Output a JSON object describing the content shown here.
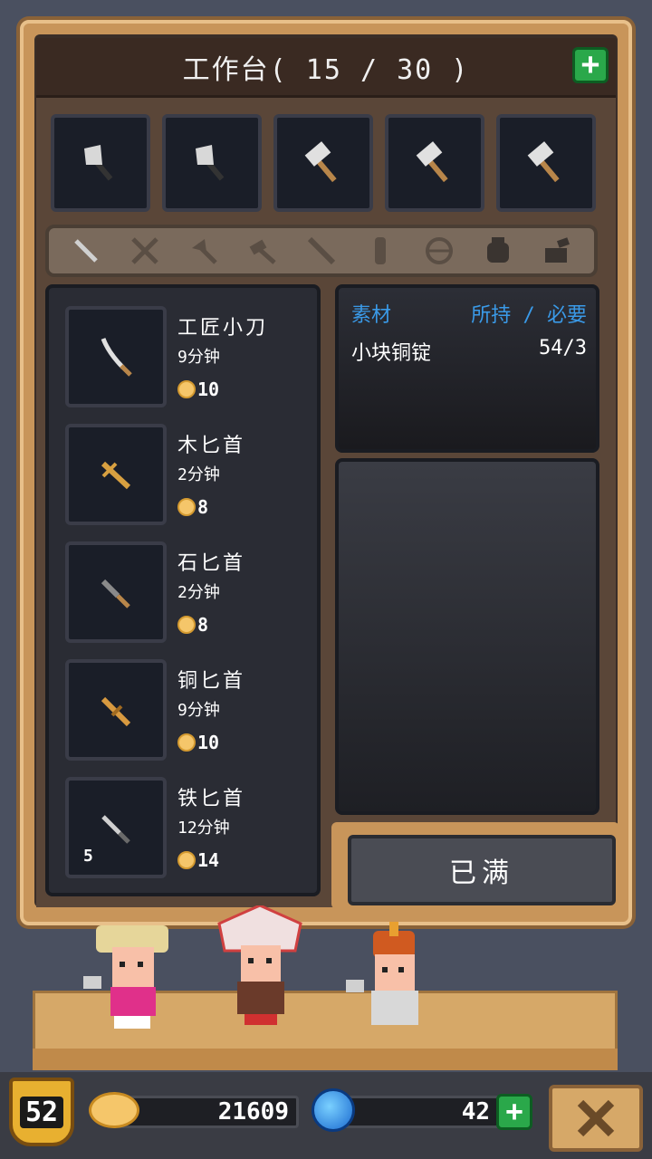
{
  "header": {
    "title": "工作台( 15 / 30 )",
    "add_label": "+"
  },
  "slots": [
    "axe-icon",
    "axe-icon",
    "hammer-icon",
    "hammer-icon",
    "hammer-icon"
  ],
  "categories": [
    "dagger-icon",
    "sword-icon",
    "axe-icon",
    "hammer-icon",
    "spear-icon",
    "mace-icon",
    "bow-icon",
    "armor-icon",
    "helmet-icon"
  ],
  "recipes": [
    {
      "name": "工匠小刀",
      "time": "9分钟",
      "cost": "10",
      "count": "",
      "icon": "knife-icon"
    },
    {
      "name": "木匕首",
      "time": "2分钟",
      "cost": "8",
      "count": "",
      "icon": "wood-dagger-icon"
    },
    {
      "name": "石匕首",
      "time": "2分钟",
      "cost": "8",
      "count": "",
      "icon": "stone-dagger-icon"
    },
    {
      "name": "铜匕首",
      "time": "9分钟",
      "cost": "10",
      "count": "",
      "icon": "copper-dagger-icon"
    },
    {
      "name": "铁匕首",
      "time": "12分钟",
      "cost": "14",
      "count": "5",
      "icon": "iron-dagger-icon"
    }
  ],
  "materials": {
    "header_left": "素材",
    "header_right": "所持 / 必要",
    "rows": [
      {
        "name": "小块铜锭",
        "value": "54/3"
      }
    ]
  },
  "action_button": "已满",
  "status": {
    "level": "52",
    "gold": "21609",
    "gems": "42",
    "gem_add": "+"
  },
  "colors": {
    "accent_green": "#2aa84a",
    "gem_blue": "#3a9ae8",
    "frame": "#c8955a"
  }
}
